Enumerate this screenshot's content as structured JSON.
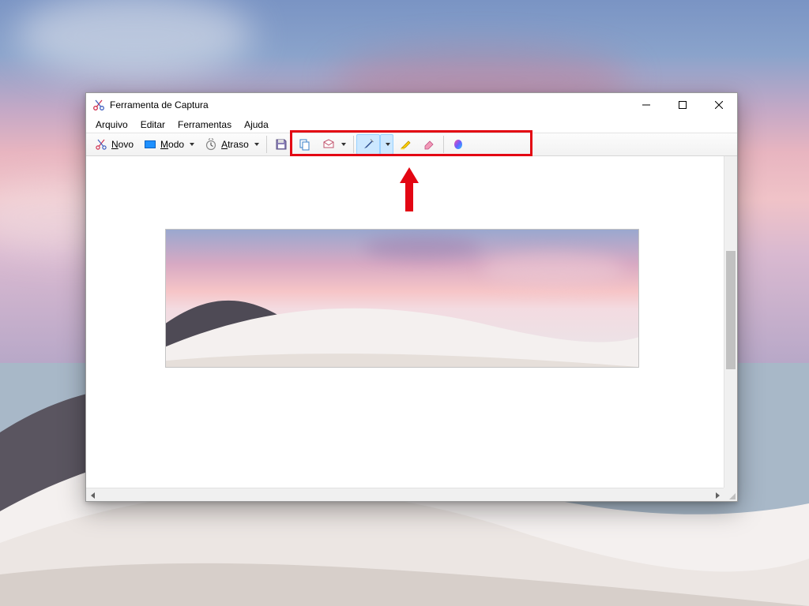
{
  "window": {
    "title": "Ferramenta de Captura"
  },
  "menubar": {
    "file": "Arquivo",
    "edit": "Editar",
    "tools": "Ferramentas",
    "help": "Ajuda"
  },
  "toolbar": {
    "new_label": "Novo",
    "new_hotkey": "N",
    "mode_label": "Modo",
    "mode_hotkey": "M",
    "delay_label": "Atraso",
    "delay_hotkey": "A",
    "icons": {
      "save": "save-icon",
      "copy": "copy-icon",
      "send": "send-mail-icon",
      "pen": "pen-icon",
      "highlighter": "highlighter-icon",
      "eraser": "eraser-icon",
      "paint3d": "paint3d-icon"
    }
  },
  "annotation": {
    "highlight_target": "edit-tools-group",
    "arrow_points_to": "pen-icon"
  },
  "colors": {
    "highlight": "#e30613",
    "pen_selection_bg": "#cce8ff"
  }
}
